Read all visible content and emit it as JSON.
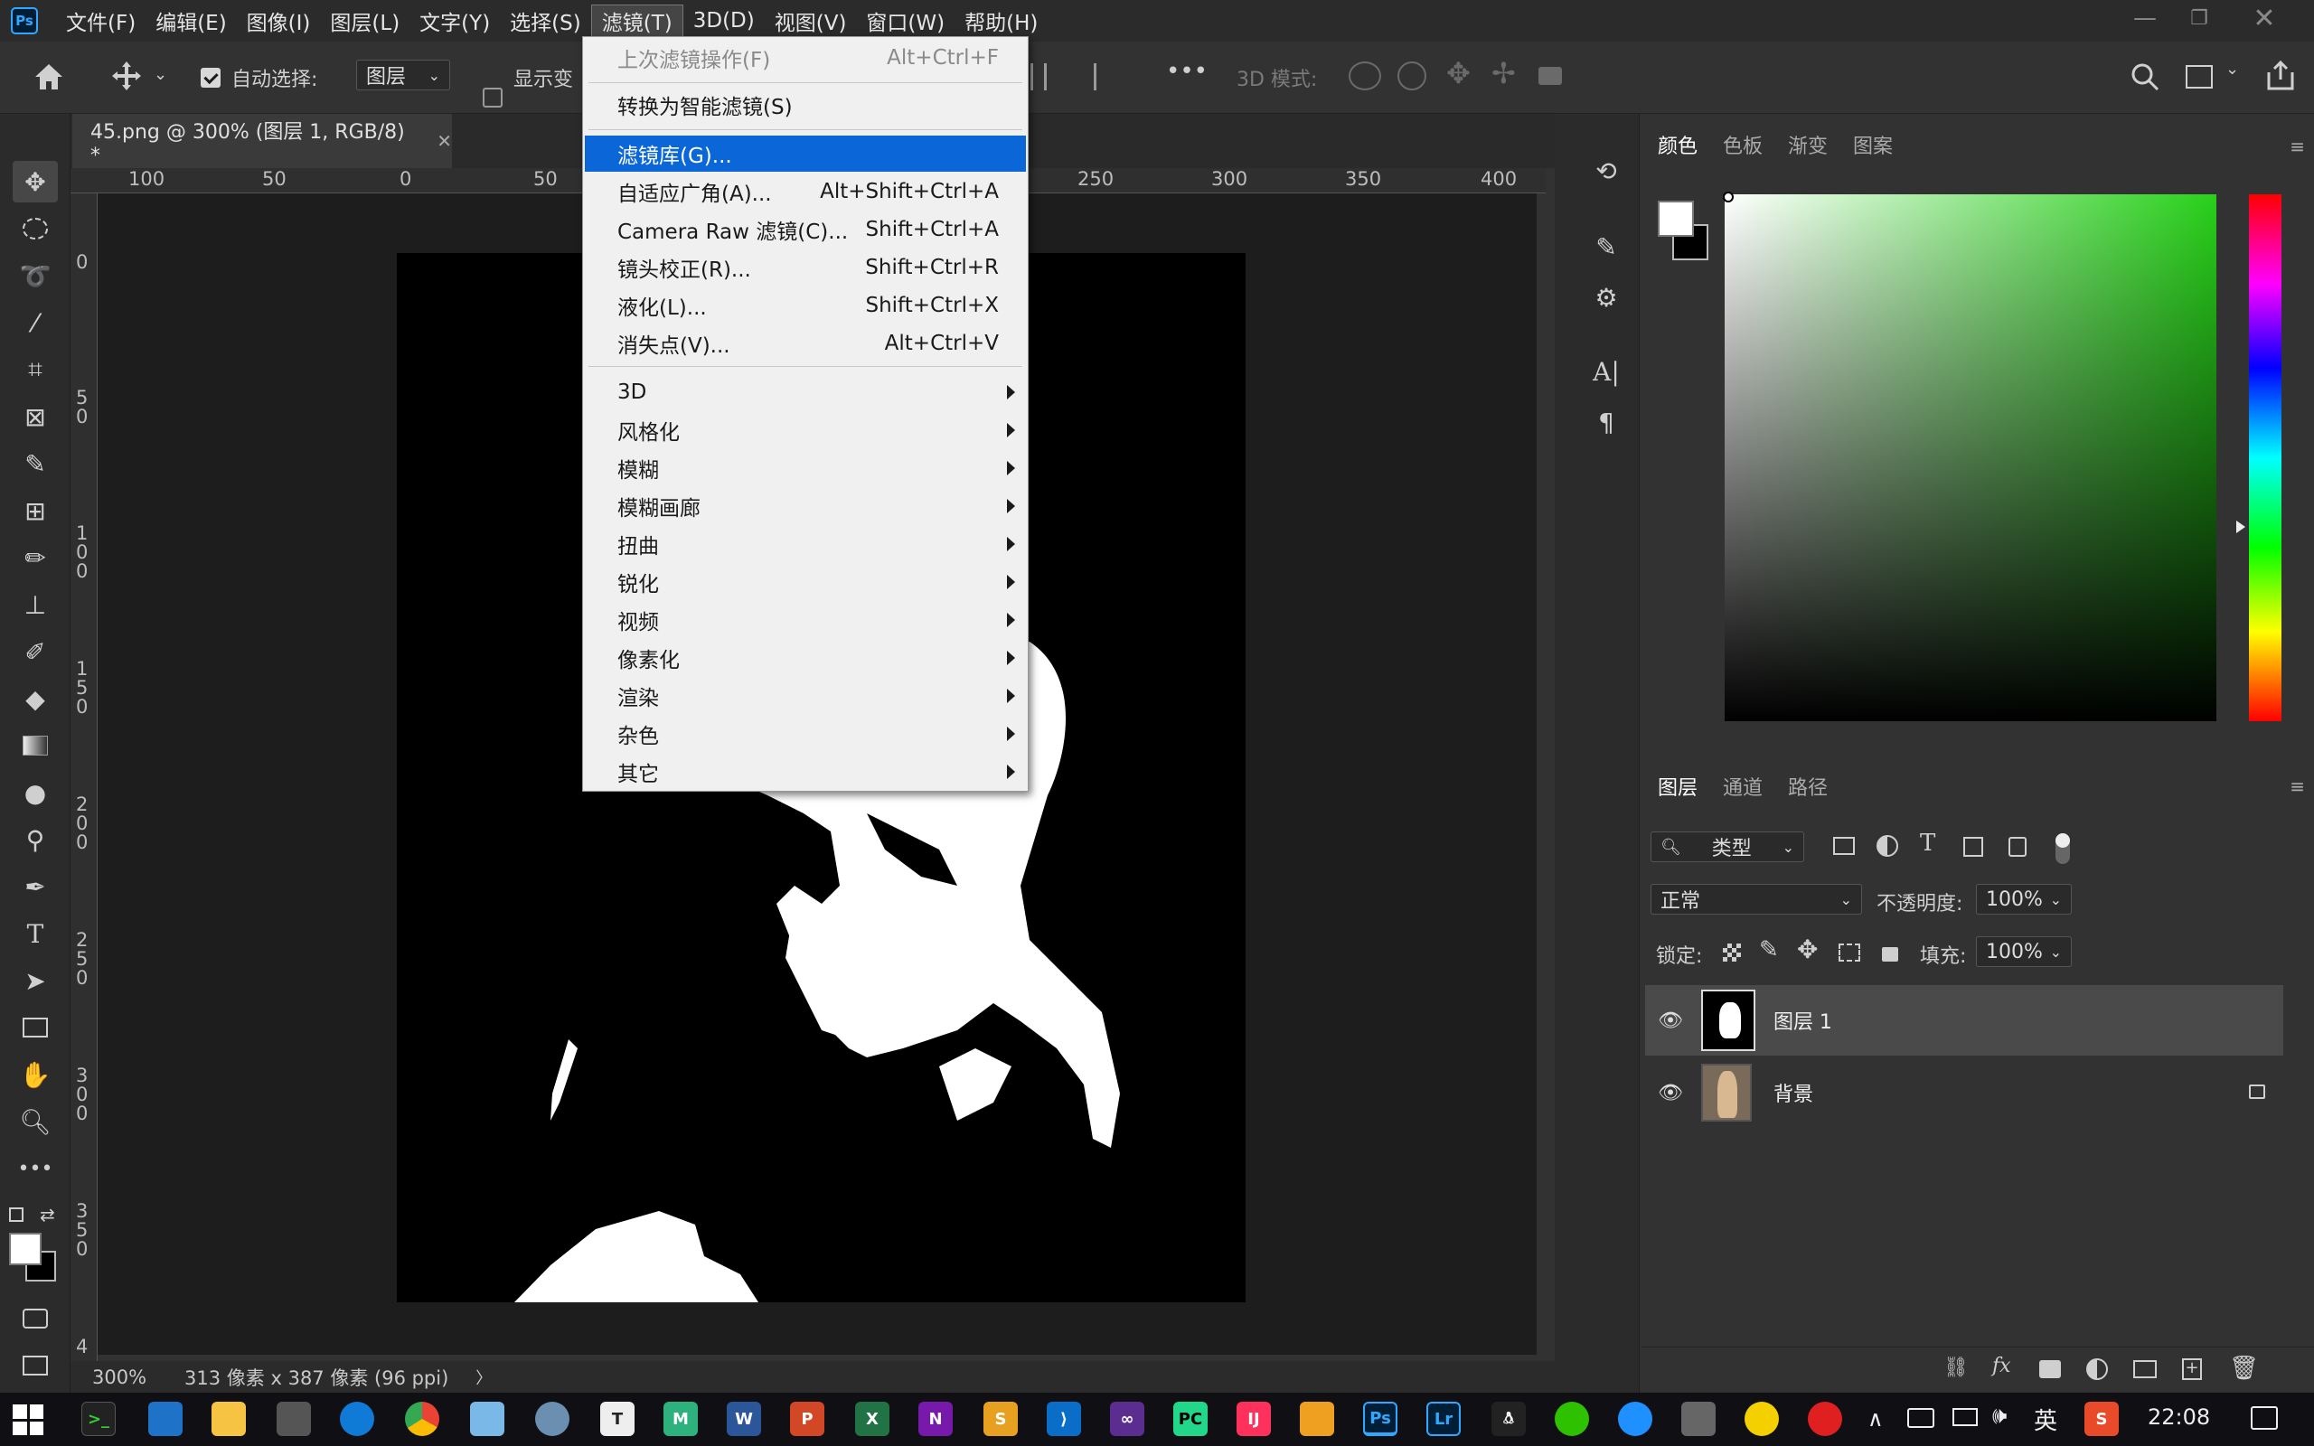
{
  "app": {
    "logo": "Ps",
    "menus": [
      "文件(F)",
      "编辑(E)",
      "图像(I)",
      "图层(L)",
      "文字(Y)",
      "选择(S)",
      "滤镜(T)",
      "3D(D)",
      "视图(V)",
      "窗口(W)",
      "帮助(H)"
    ],
    "active_menu_index": 6
  },
  "options": {
    "auto_select_label": "自动选择:",
    "auto_select_value": "图层",
    "show_transform_label": "显示变",
    "mode_3d_label": "3D 模式:",
    "more_label": "•••"
  },
  "document": {
    "tab_title": "45.png @ 300% (图层 1, RGB/8) *",
    "ruler_top": [
      "100",
      "50",
      "0",
      "50",
      "250",
      "300",
      "350",
      "400"
    ],
    "ruler_left": [
      "0",
      "5\n0",
      "1\n0\n0",
      "1\n5\n0",
      "2\n0\n0",
      "2\n5\n0",
      "3\n0\n0",
      "3\n5\n0",
      "4"
    ],
    "zoom": "300%",
    "size_info": "313 像素 x 387 像素 (96 ppi)"
  },
  "filter_menu": {
    "last_filter": {
      "label": "上次滤镜操作(F)",
      "shortcut": "Alt+Ctrl+F"
    },
    "smart_filter": "转换为智能滤镜(S)",
    "items": [
      {
        "label": "滤镜库(G)...",
        "shortcut": ""
      },
      {
        "label": "自适应广角(A)...",
        "shortcut": "Alt+Shift+Ctrl+A"
      },
      {
        "label": "Camera Raw 滤镜(C)...",
        "shortcut": "Shift+Ctrl+A"
      },
      {
        "label": "镜头校正(R)...",
        "shortcut": "Shift+Ctrl+R"
      },
      {
        "label": "液化(L)...",
        "shortcut": "Shift+Ctrl+X"
      },
      {
        "label": "消失点(V)...",
        "shortcut": "Alt+Ctrl+V"
      }
    ],
    "submenus": [
      "3D",
      "风格化",
      "模糊",
      "模糊画廊",
      "扭曲",
      "锐化",
      "视频",
      "像素化",
      "渲染",
      "杂色",
      "其它"
    ]
  },
  "color_panel": {
    "tabs": [
      "颜色",
      "色板",
      "渐变",
      "图案"
    ],
    "active_tab": 0
  },
  "layers_panel": {
    "tabs": [
      "图层",
      "通道",
      "路径"
    ],
    "filter_kind": "类型",
    "blend_mode": "正常",
    "opacity_label": "不透明度:",
    "opacity_value": "100%",
    "lock_label": "锁定:",
    "fill_label": "填充:",
    "fill_value": "100%",
    "layers": [
      {
        "name": "图层 1",
        "visible": true,
        "selected": true,
        "locked": false
      },
      {
        "name": "背景",
        "visible": true,
        "selected": false,
        "locked": true
      }
    ]
  },
  "taskbar": {
    "ime": "英",
    "time": "22:08"
  },
  "colors": {
    "accent": "#0b67d8",
    "ps_blue": "#31a8ff",
    "hue_marker_color": "#28d11a"
  }
}
